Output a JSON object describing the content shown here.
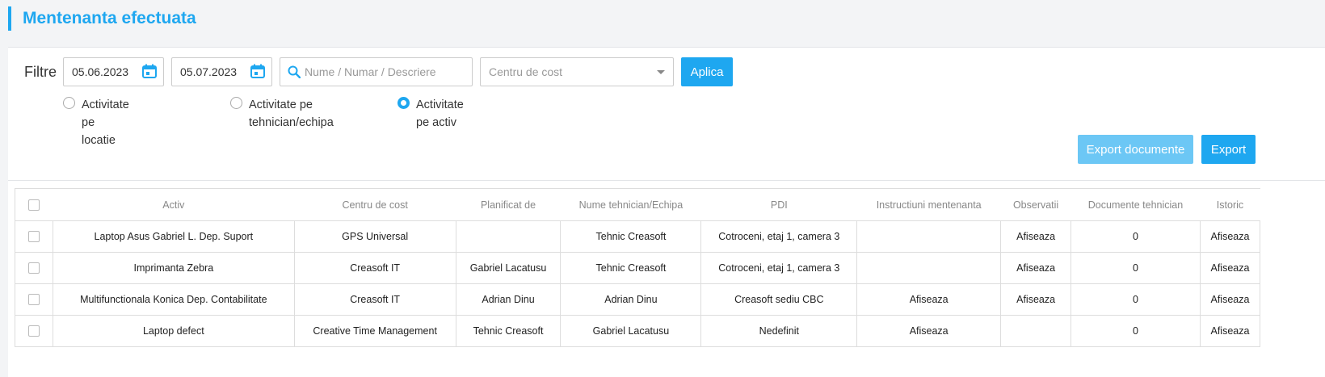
{
  "page": {
    "title": "Mentenanta efectuata"
  },
  "filters": {
    "label": "Filtre",
    "date_from": "05.06.2023",
    "date_to": "05.07.2023",
    "search_placeholder": "Nume / Numar / Descriere",
    "cost_center_placeholder": "Centru de cost",
    "apply_label": "Aplica",
    "radios": [
      {
        "label_line1": "Activitate pe locatie",
        "label_line2": "",
        "checked": false
      },
      {
        "label_line1": "Activitate pe",
        "label_line2": "tehnician/echipa",
        "checked": false
      },
      {
        "label_line1": "Activitate pe activ",
        "label_line2": "",
        "checked": true
      }
    ]
  },
  "actions": {
    "export_documents": "Export documente",
    "export": "Export"
  },
  "table": {
    "headers": [
      "Activ",
      "Centru de cost",
      "Planificat de",
      "Nume tehnician/Echipa",
      "PDI",
      "Instructiuni mentenanta",
      "Observatii",
      "Documente tehnician",
      "Istoric"
    ],
    "rows": [
      {
        "activ": "Laptop Asus Gabriel L. Dep. Suport",
        "centru": "GPS Universal",
        "planificat": "",
        "tehnician": "Tehnic Creasoft",
        "pdi": "Cotroceni, etaj 1, camera 3",
        "instructiuni": "",
        "observatii": "Afiseaza",
        "documente": "0",
        "istoric": "Afiseaza"
      },
      {
        "activ": "Imprimanta Zebra",
        "centru": "Creasoft IT",
        "planificat": "Gabriel Lacatusu",
        "tehnician": "Tehnic Creasoft",
        "pdi": "Cotroceni, etaj 1, camera 3",
        "instructiuni": "",
        "observatii": "Afiseaza",
        "documente": "0",
        "istoric": "Afiseaza"
      },
      {
        "activ": "Multifunctionala Konica Dep. Contabilitate",
        "centru": "Creasoft IT",
        "planificat": "Adrian Dinu",
        "tehnician": "Adrian Dinu",
        "pdi": "Creasoft sediu CBC",
        "instructiuni": "Afiseaza",
        "observatii": "Afiseaza",
        "documente": "0",
        "istoric": "Afiseaza"
      },
      {
        "activ": "Laptop defect",
        "centru": "Creative Time Management",
        "planificat": "Tehnic Creasoft",
        "tehnician": "Gabriel Lacatusu",
        "pdi": "Nedefinit",
        "instructiuni": "Afiseaza",
        "observatii": "",
        "documente": "0",
        "istoric": "Afiseaza"
      }
    ]
  },
  "colors": {
    "accent": "#1ea7f0",
    "accent_light": "#6cc7f5"
  }
}
